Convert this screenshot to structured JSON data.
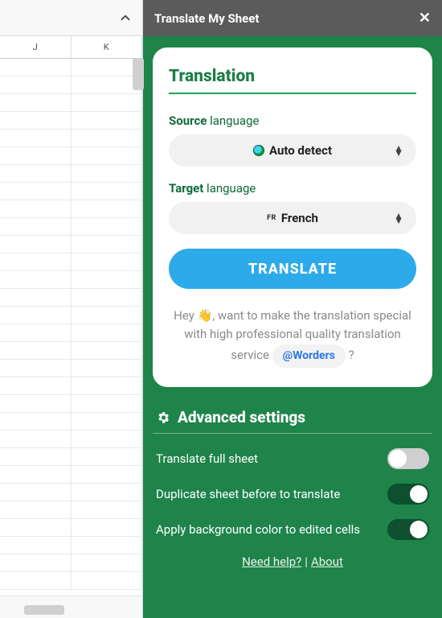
{
  "sheet": {
    "cols": [
      "J",
      "K"
    ]
  },
  "panel": {
    "title": "Translate My Sheet"
  },
  "card": {
    "title": "Translation",
    "source_label_b": "Source",
    "source_label_r": " language",
    "source_value": "Auto detect",
    "target_label_b": "Target",
    "target_label_r": " language",
    "target_prefix": "FR",
    "target_value": "French",
    "translate_btn": "TRANSLATE",
    "promo_pre": "Hey ",
    "promo_mid": ", want to make the translation special with high professional quality translation service ",
    "promo_chip": "@Worders",
    "promo_post": " ?"
  },
  "advanced": {
    "title": "Advanced settings",
    "settings": [
      {
        "label": "Translate full sheet",
        "on": false
      },
      {
        "label": "Duplicate sheet before to translate",
        "on": true
      },
      {
        "label": "Apply background color to edited cells",
        "on": true
      }
    ]
  },
  "footer": {
    "help": "Need help?",
    "about": "About"
  }
}
